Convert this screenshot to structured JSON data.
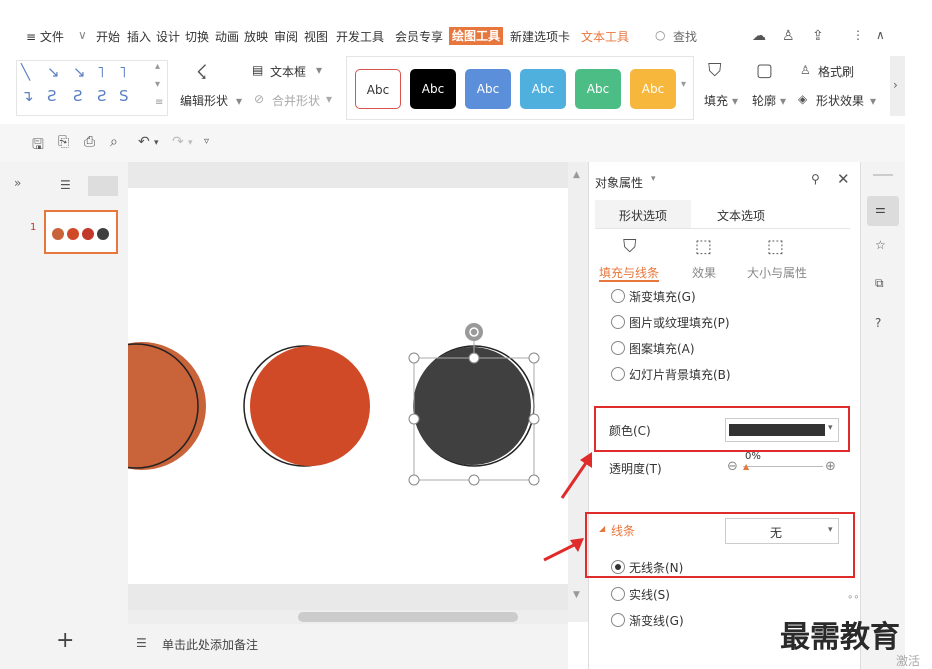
{
  "menubar": {
    "items": [
      "≡ 文件",
      "开始",
      "插入",
      "设计",
      "切换",
      "动画",
      "放映",
      "审阅",
      "视图",
      "开发工具",
      "会员专享",
      "绘图工具",
      "新建选项卡",
      "文本工具"
    ],
    "search": "查找",
    "active": "绘图工具"
  },
  "ribbon": {
    "edit_shape": "编辑形状",
    "textbox": "文本框",
    "merge_shape": "合并形状",
    "swatches": [
      "Abc",
      "Abc",
      "Abc",
      "Abc",
      "Abc",
      "Abc"
    ],
    "fill": "填充",
    "outline": "轮廓",
    "format_brush": "格式刷",
    "shape_effect": "形状效果"
  },
  "slides": {
    "number": "1"
  },
  "notes": {
    "placeholder": "单击此处添加备注"
  },
  "panel": {
    "title": "对象属性",
    "tabs": [
      "形状选项",
      "文本选项"
    ],
    "subtabs": [
      "填充与线条",
      "效果",
      "大小与属性"
    ],
    "fill_options": [
      "渐变填充(G)",
      "图片或纹理填充(P)",
      "图案填充(A)",
      "幻灯片背景填充(B)"
    ],
    "color_label": "颜色(C)",
    "color_value": "#333333",
    "transparency_label": "透明度(T)",
    "transparency_value": "0%",
    "line_section": "线条",
    "line_value": "无",
    "line_options": [
      "无线条(N)",
      "实线(S)",
      "渐变线(G)"
    ]
  },
  "watermark": {
    "text": "最需教育",
    "sub": "激活"
  },
  "colors": {
    "accent": "#e8773d",
    "red_annotation": "#e02b2b",
    "circle_orange": "#c8633a",
    "circle_red": "#d14a28",
    "circle_dark": "#404040"
  }
}
